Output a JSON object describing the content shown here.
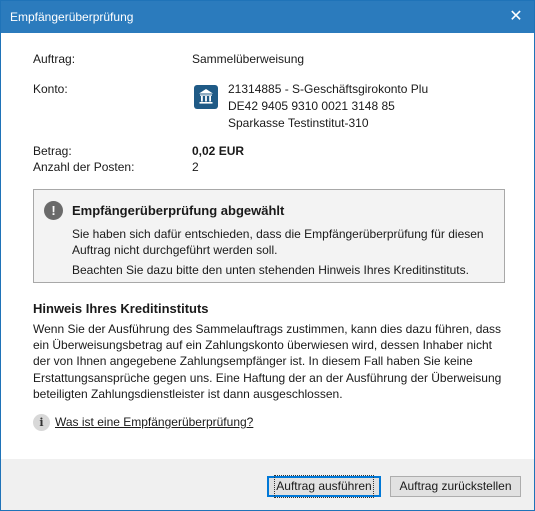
{
  "window": {
    "title": "Empfängerüberprüfung",
    "close_glyph": "✕"
  },
  "order": {
    "label": "Auftrag:",
    "value": "Sammelüberweisung"
  },
  "account": {
    "label": "Konto:",
    "icon": "bank-icon",
    "line1": "21314885 - S-Geschäftsgirokonto Plu",
    "line2": "DE42 9405 9310 0021 3148 85",
    "line3": "Sparkasse Testinstitut-310"
  },
  "amount": {
    "label": "Betrag:",
    "value": "0,02 EUR"
  },
  "count": {
    "label": "Anzahl der Posten:",
    "value": "2"
  },
  "warning": {
    "icon": "exclamation-icon",
    "icon_glyph": "!",
    "title": "Empfängerüberprüfung abgewählt",
    "text1": "Sie haben sich dafür entschieden, dass die Empfängerüberprüfung für diesen Auftrag nicht durchgeführt werden soll.",
    "text2": "Beachten Sie dazu bitte den unten stehenden Hinweis Ihres Kreditinstituts."
  },
  "hint": {
    "title": "Hinweis Ihres Kreditinstituts",
    "text": "Wenn Sie der Ausführung des Sammelauftrags zustimmen, kann dies dazu führen, dass ein Überweisungsbetrag auf ein Zahlungskonto überwiesen wird, dessen Inhaber nicht der von Ihnen angegebene Zahlungsempfänger ist. In diesem Fall haben Sie keine Erstattungsansprüche gegen uns. Eine Haftung der an der Ausführung der Überweisung beteiligten Zahlungsdienstleister ist dann ausgeschlossen.",
    "info_glyph": "i",
    "link": "Was ist eine Empfängerüberprüfung?"
  },
  "buttons": {
    "execute": "Auftrag ausführen",
    "defer": "Auftrag zurückstellen"
  },
  "colors": {
    "titlebar": "#2b7bbd",
    "bank_icon": "#1f5a86"
  }
}
